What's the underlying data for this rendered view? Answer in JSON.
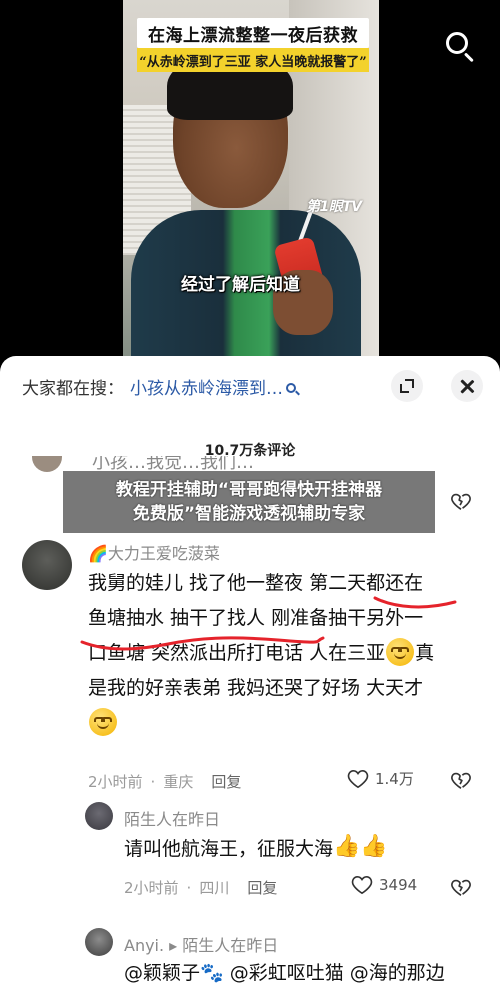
{
  "video": {
    "title": "在海上漂流整整一夜后获救",
    "subtitle": "“从赤岭漂到了三亚 家人当晚就报警了”",
    "caption": "经过了解后知道",
    "channel_logo": "第1眼TV"
  },
  "sheet": {
    "search_prefix": "大家都在搜：",
    "search_query": "小孩从赤岭海漂到…",
    "comment_count": "10.7万条评论",
    "prev_comment_text": "小孩…我觉…我们…",
    "overlay_text_line1": "教程开挂辅助“哥哥跑得快开挂神器",
    "overlay_text_line2": "免费版”智能游戏透视辅助专家"
  },
  "comments": [
    {
      "username": "🌈大力王爱吃菠菜",
      "text_line1": "我舅的娃儿 找了他一整夜 第二天都还在",
      "text_line2": "鱼塘抽水 抽干了找人 刚准备抽干另外一",
      "text_line3a": "口鱼塘 突然派出所打电话 人在三亚",
      "text_line3b": "真",
      "text_line4": "是我的好亲表弟 我妈还哭了好场 大天才",
      "time": "2小时前",
      "location": "重庆",
      "reply_label": "回复",
      "likes": "1.4万"
    },
    {
      "username": "陌生人在昨日",
      "text": "请叫他航海王，征服大海",
      "time": "2小时前",
      "location": "四川",
      "reply_label": "回复",
      "likes": "3494"
    },
    {
      "username": "Anyi. ▸ 陌生人在昨日",
      "text": "@颖颖子🐾 @彩虹呕吐猫 @海的那边"
    }
  ],
  "colors": {
    "link_blue": "#2c5aa6",
    "banner_yellow": "#f3d22c",
    "annotation_red": "#e5232b",
    "meta_gray": "#9a9a9a"
  }
}
